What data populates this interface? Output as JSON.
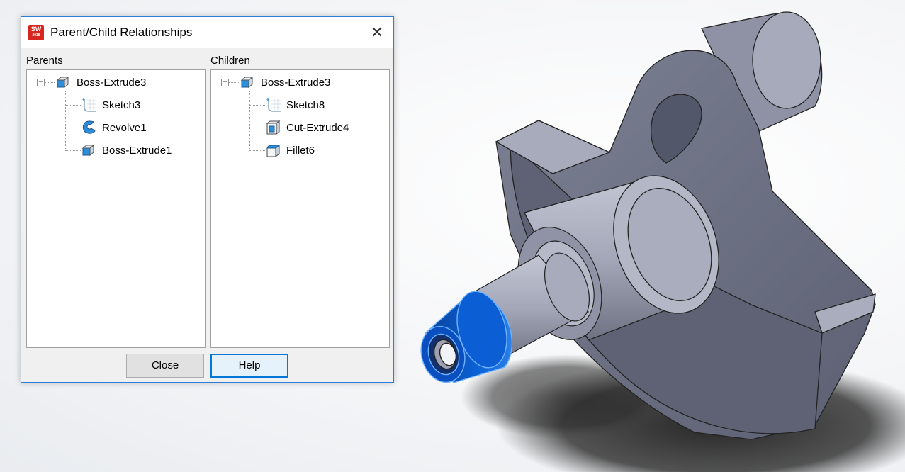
{
  "dialog": {
    "title": "Parent/Child Relationships",
    "app_icon_text": "SW",
    "app_icon_subtext": "2018",
    "close_glyph": "✕",
    "parents": {
      "label": "Parents",
      "root": {
        "label": "Boss-Extrude3",
        "icon": "boss-extrude-icon",
        "expander": "−"
      },
      "items": [
        {
          "label": "Sketch3",
          "icon": "sketch-icon"
        },
        {
          "label": "Revolve1",
          "icon": "revolve-icon"
        },
        {
          "label": "Boss-Extrude1",
          "icon": "boss-extrude-icon"
        }
      ]
    },
    "children": {
      "label": "Children",
      "root": {
        "label": "Boss-Extrude3",
        "icon": "boss-extrude-icon",
        "expander": "−"
      },
      "items": [
        {
          "label": "Sketch8",
          "icon": "sketch-icon"
        },
        {
          "label": "Cut-Extrude4",
          "icon": "cut-extrude-icon"
        },
        {
          "label": "Fillet6",
          "icon": "fillet-icon"
        }
      ]
    },
    "buttons": {
      "close": "Close",
      "help": "Help"
    }
  },
  "colors": {
    "accent": "#0078d7",
    "dialog_border": "#2b7fd6",
    "selected_face": "#0a5fd0",
    "part_gray": "#9fa3b5",
    "app_icon_red": "#d7261e"
  }
}
